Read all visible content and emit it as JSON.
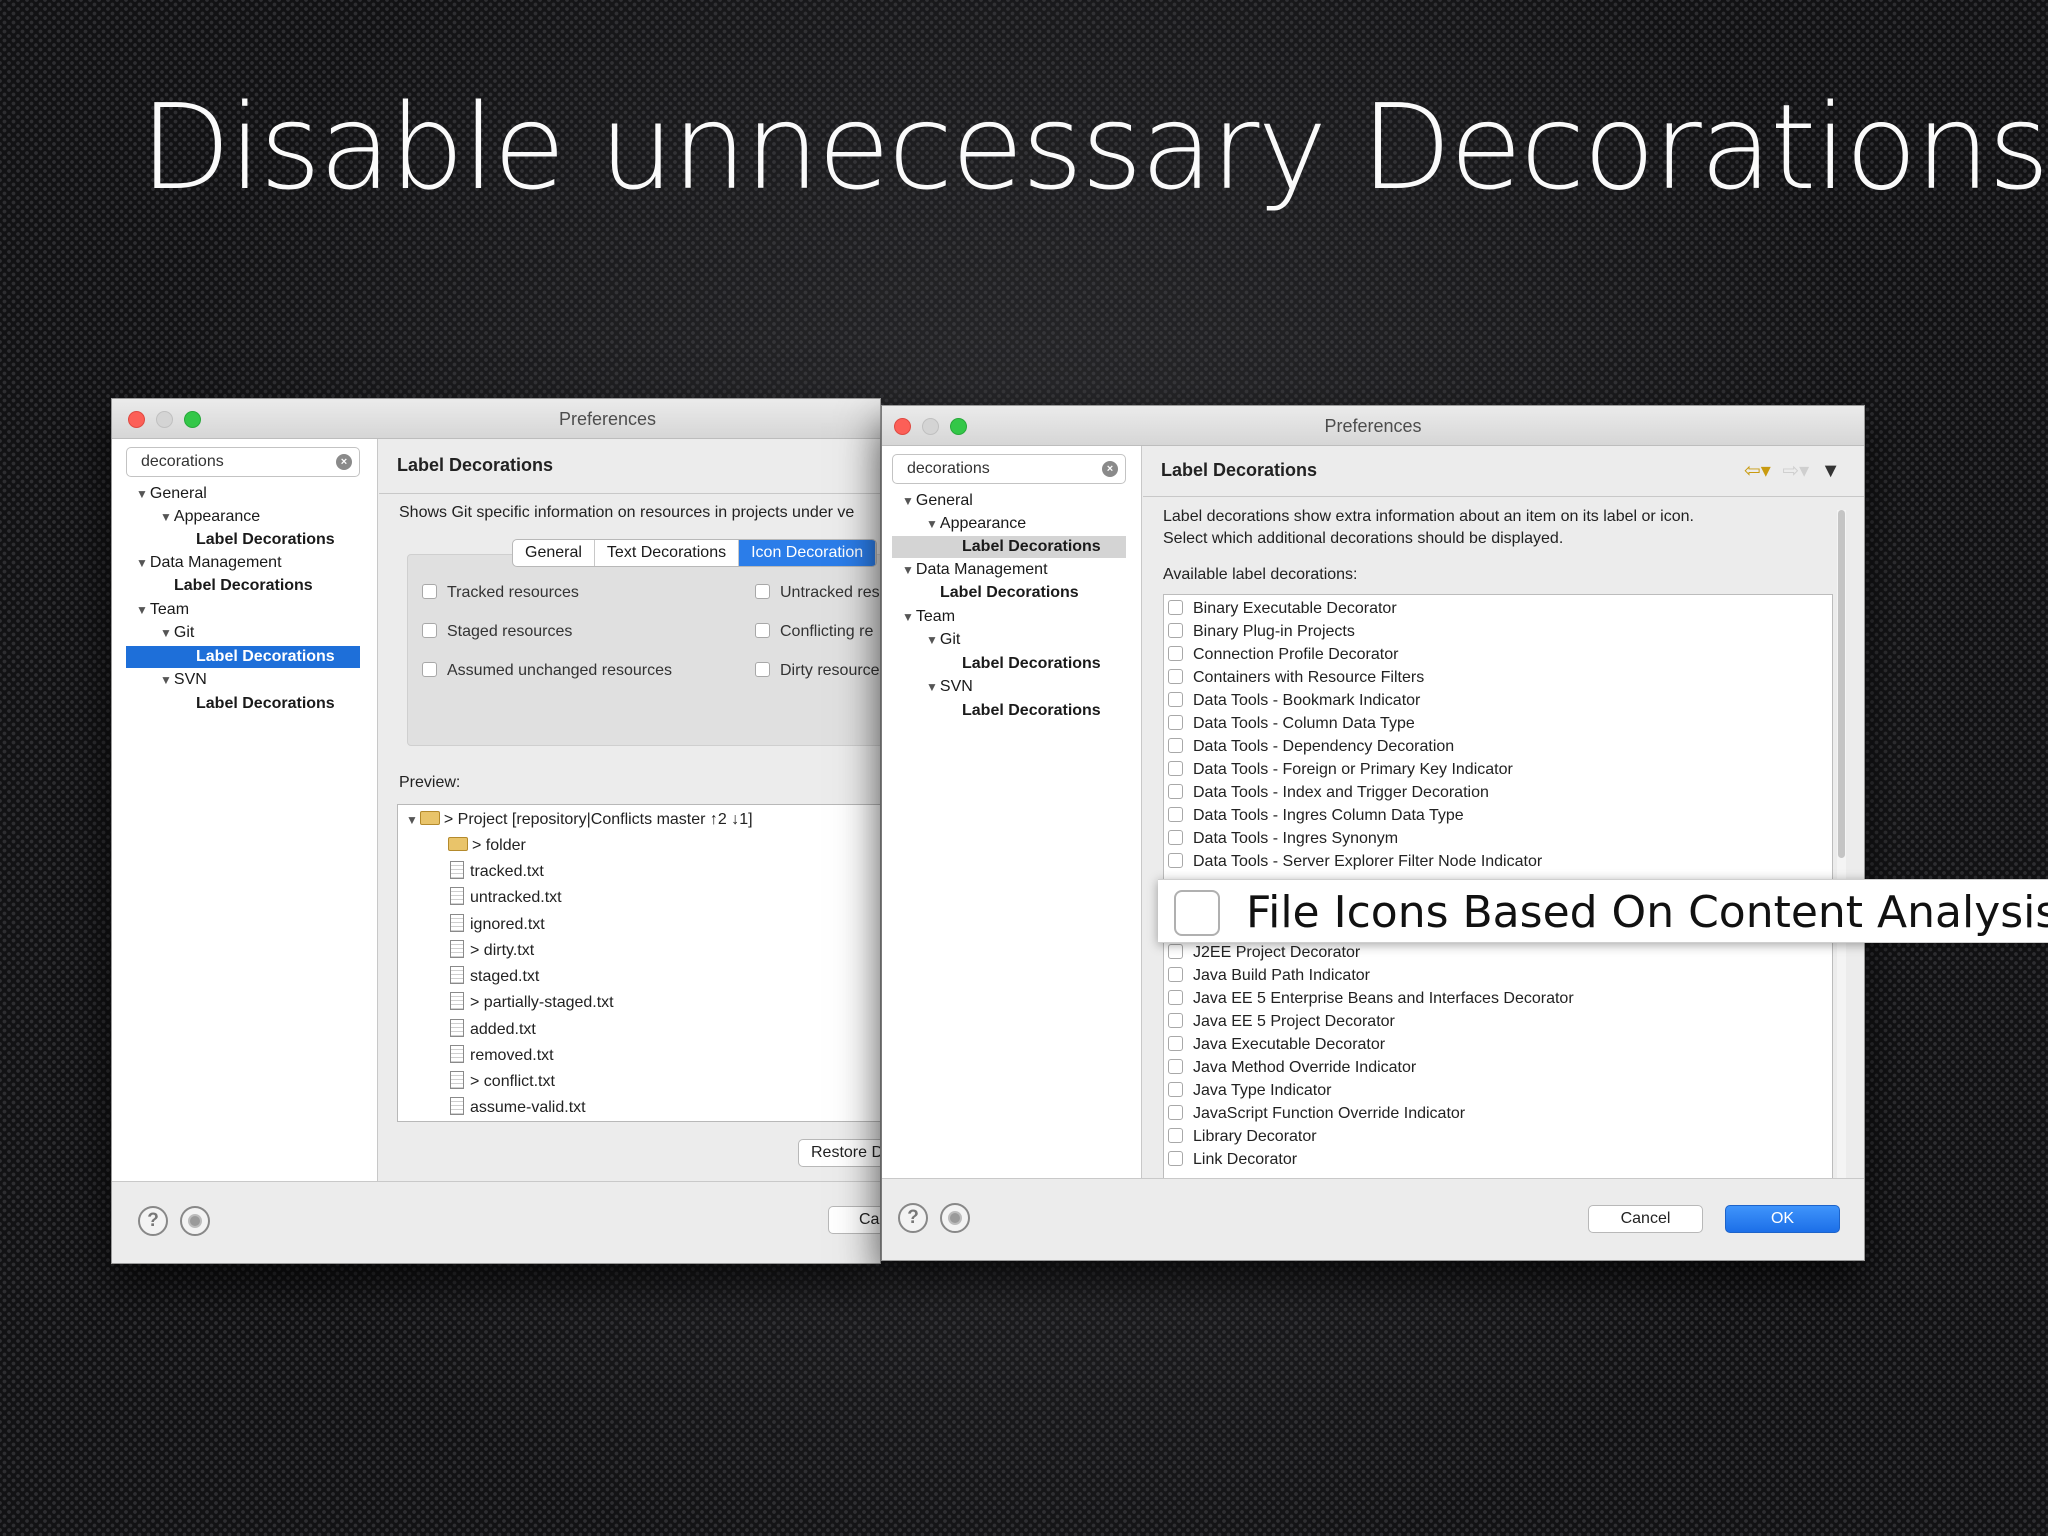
{
  "slide": {
    "title": "Disable unnecessary Decorations"
  },
  "left_window": {
    "title": "Preferences",
    "search": "decorations",
    "tree": [
      {
        "label": "General",
        "expanded": true
      },
      {
        "label": "Appearance",
        "expanded": true
      },
      {
        "label": "Label Decorations"
      },
      {
        "label": "Data Management",
        "expanded": true
      },
      {
        "label": "Label Decorations"
      },
      {
        "label": "Team",
        "expanded": true
      },
      {
        "label": "Git",
        "expanded": true
      },
      {
        "label": "Label Decorations",
        "selected": true
      },
      {
        "label": "SVN",
        "expanded": true
      },
      {
        "label": "Label Decorations"
      }
    ],
    "pane_title": "Label Decorations",
    "description": "Shows Git specific information on resources in projects under ve",
    "tabs": [
      "General",
      "Text Decorations",
      "Icon Decoration"
    ],
    "checkboxes_left": [
      "Tracked resources",
      "Staged resources",
      "Assumed unchanged resources"
    ],
    "checkboxes_right": [
      "Untracked res",
      "Conflicting re",
      "Dirty resource"
    ],
    "preview_label": "Preview:",
    "preview": [
      "> Project  [repository|Conflicts master ↑2 ↓1]",
      "> folder",
      "tracked.txt",
      "untracked.txt",
      "ignored.txt",
      "> dirty.txt",
      "staged.txt",
      "> partially-staged.txt",
      "added.txt",
      "removed.txt",
      "> conflict.txt",
      "assume-valid.txt"
    ],
    "restore_label": "Restore D",
    "cancel_label": "Ca"
  },
  "right_window": {
    "title": "Preferences",
    "search": "decorations",
    "tree": [
      {
        "label": "General",
        "expanded": true
      },
      {
        "label": "Appearance",
        "expanded": true
      },
      {
        "label": "Label Decorations",
        "selected": true
      },
      {
        "label": "Data Management",
        "expanded": true
      },
      {
        "label": "Label Decorations"
      },
      {
        "label": "Team",
        "expanded": true
      },
      {
        "label": "Git",
        "expanded": true
      },
      {
        "label": "Label Decorations"
      },
      {
        "label": "SVN",
        "expanded": true
      },
      {
        "label": "Label Decorations"
      }
    ],
    "pane_title": "Label Decorations",
    "description_line1": "Label decorations show extra information about an item on its label or icon.",
    "description_line2": "Select which additional decorations should be displayed.",
    "available_label": "Available label decorations:",
    "decorations_top": [
      "Binary Executable Decorator",
      "Binary Plug-in Projects",
      "Connection Profile Decorator",
      "Containers with Resource Filters",
      "Data Tools - Bookmark Indicator",
      "Data Tools - Column Data Type",
      "Data Tools - Dependency Decoration",
      "Data Tools - Foreign or Primary Key Indicator",
      "Data Tools - Index and Trigger Decoration",
      "Data Tools - Ingres Column Data Type",
      "Data Tools - Ingres Synonym",
      "Data Tools - Server Explorer Filter Node Indicator"
    ],
    "decorations_bottom": [
      "J2EE Project Decorator",
      "Java Build Path Indicator",
      "Java EE 5 Enterprise Beans and Interfaces Decorator",
      "Java EE 5 Project Decorator",
      "Java Executable Decorator",
      "Java Method Override Indicator",
      "Java Type Indicator",
      "JavaScript Function Override Indicator",
      "Library Decorator",
      "Link Decorator"
    ],
    "zoomed_item": "File Icons Based On Content Analysis",
    "cancel_label": "Cancel",
    "ok_label": "OK"
  },
  "colors": {
    "selection_blue": "#1e6fd9",
    "ok_button": "#2b7de9",
    "close_red": "#fc5f57",
    "zoom_green": "#33c748"
  },
  "icons": [
    "search-clear-icon",
    "help-icon",
    "record-icon",
    "back-arrow-icon",
    "forward-arrow-icon",
    "menu-chevron-icon",
    "folder-icon",
    "file-icon"
  ]
}
